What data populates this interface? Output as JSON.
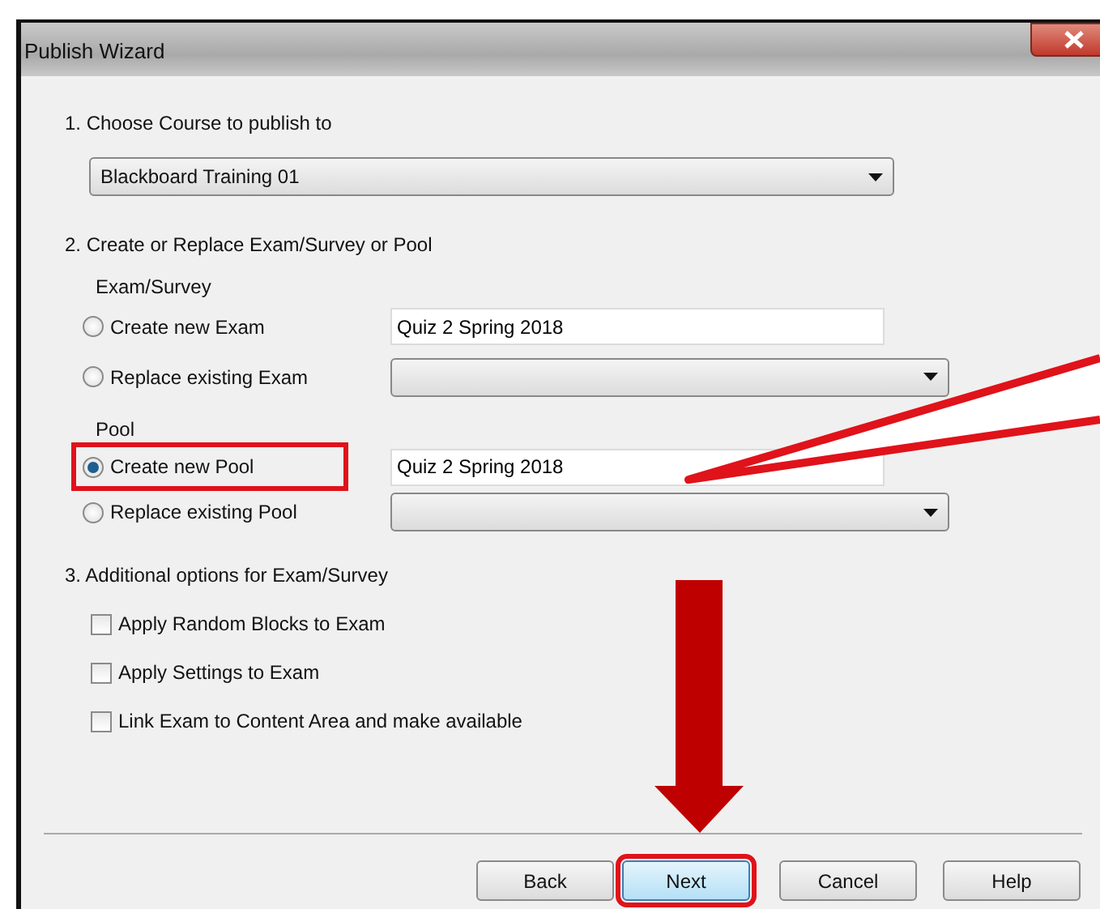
{
  "window": {
    "title": "Publish Wizard"
  },
  "step1": {
    "label": "1.  Choose Course to publish to",
    "course": "Blackboard Training 01"
  },
  "step2": {
    "label": "2.  Create or Replace Exam/Survey or Pool",
    "groups": [
      {
        "heading": "Exam/Survey",
        "options": [
          {
            "label": "Create new Exam",
            "selected": false,
            "highlighted": false,
            "kind": "text",
            "value": "Quiz 2 Spring 2018"
          },
          {
            "label": "Replace existing Exam",
            "selected": false,
            "highlighted": false,
            "kind": "dropdown"
          }
        ]
      },
      {
        "heading": "Pool",
        "options": [
          {
            "label": "Create new Pool",
            "selected": true,
            "highlighted": true,
            "kind": "text",
            "value": "Quiz 2 Spring 2018"
          },
          {
            "label": "Replace existing Pool",
            "selected": false,
            "highlighted": false,
            "kind": "dropdown"
          }
        ]
      }
    ]
  },
  "step3": {
    "label": "3.  Additional options for Exam/Survey",
    "options": [
      {
        "label": "Apply Random Blocks to Exam",
        "checked": false
      },
      {
        "label": "Apply Settings to Exam",
        "checked": false
      },
      {
        "label": "Link Exam to Content Area and make available",
        "checked": false
      }
    ]
  },
  "buttons": [
    {
      "label": "Back",
      "focused": false,
      "highlighted": false
    },
    {
      "label": "Next",
      "focused": true,
      "highlighted": true
    },
    {
      "label": "Cancel",
      "focused": false,
      "highlighted": false
    },
    {
      "label": "Help",
      "focused": false,
      "highlighted": false
    }
  ],
  "annotations": {
    "callout": true,
    "arrow": true
  }
}
